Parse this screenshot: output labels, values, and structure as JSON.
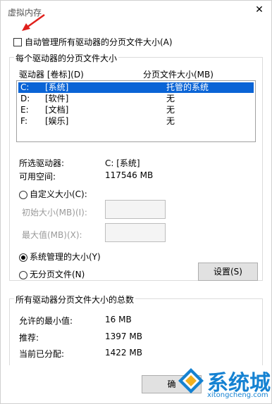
{
  "window": {
    "title": "虚拟内存",
    "close_label": "✕"
  },
  "auto_manage": {
    "label": "自动管理所有驱动器的分页文件大小(A)",
    "checked": false
  },
  "drives_group": {
    "title": "每个驱动器的分页文件大小",
    "col_drive": "驱动器 [卷标](D)",
    "col_size": "分页文件大小(MB)",
    "rows": [
      {
        "drive": "C:",
        "label": "[系统]",
        "size": "托管的系统",
        "selected": true
      },
      {
        "drive": "D:",
        "label": "[软件]",
        "size": "无",
        "selected": false
      },
      {
        "drive": "E:",
        "label": "[文档]",
        "size": "无",
        "selected": false
      },
      {
        "drive": "F:",
        "label": "[娱乐]",
        "size": "无",
        "selected": false
      }
    ],
    "selected_drive_label": "所选驱动器:",
    "selected_drive_value": "C:  [系统]",
    "free_space_label": "可用空间:",
    "free_space_value": "117546 MB",
    "custom_size_label": "自定义大小(C):",
    "initial_size_label": "初始大小(MB)(I):",
    "max_size_label": "最大值(MB)(X):",
    "system_managed_label": "系统管理的大小(Y)",
    "no_paging_label": "无分页文件(N)",
    "set_button": "设置(S)",
    "selected_option": "system_managed"
  },
  "totals_group": {
    "title": "所有驱动器分页文件大小的总数",
    "min_label": "允许的最小值:",
    "min_value": "16 MB",
    "recommended_label": "推荐:",
    "recommended_value": "1397 MB",
    "current_label": "当前已分配:",
    "current_value": "1422 MB"
  },
  "footer": {
    "ok_button": "确"
  },
  "watermark": {
    "text": "系统城",
    "url": "xitongcheng.com"
  },
  "colors": {
    "selection": "#0a64d6",
    "arrow": "#e0201c",
    "watermark": "#1582d2"
  }
}
